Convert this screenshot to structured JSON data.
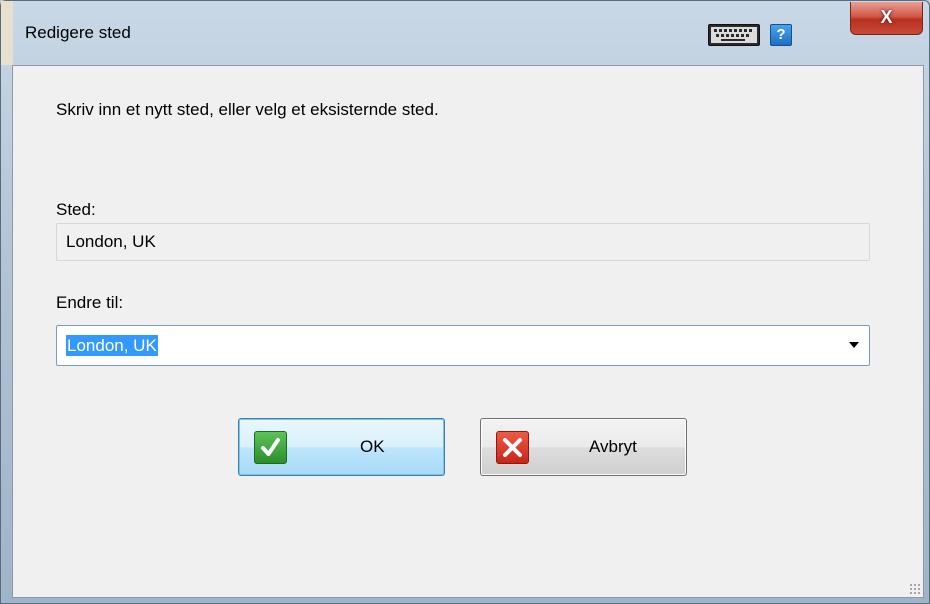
{
  "window": {
    "title": "Redigere sted"
  },
  "titlebar": {
    "keyboard_icon": "keyboard-icon",
    "help_label": "?",
    "close_label": "X"
  },
  "dialog": {
    "instruction": "Skriv inn et nytt sted, eller velg et eksisternde sted.",
    "current_label": "Sted:",
    "current_value": "London, UK",
    "change_label": "Endre til:",
    "change_value": "London, UK"
  },
  "buttons": {
    "ok_label": "OK",
    "ok_icon": "checkmark-icon",
    "cancel_label": "Avbryt",
    "cancel_icon": "cross-icon"
  },
  "colors": {
    "selection": "#3399ff",
    "ok_icon_bg": "#2c8f2a",
    "cancel_icon_bg": "#c8261a",
    "close_button": "#c84a38"
  }
}
